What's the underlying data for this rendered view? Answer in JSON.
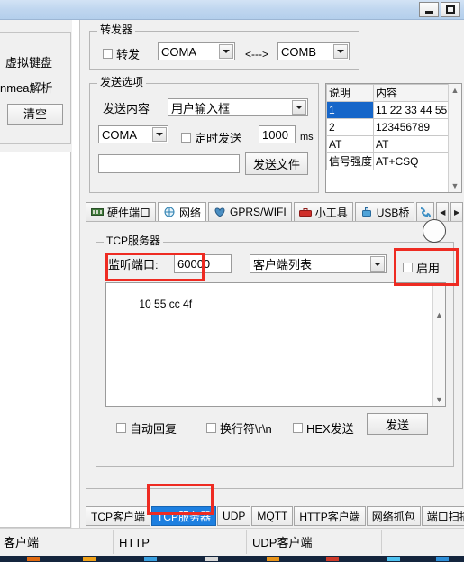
{
  "window": {
    "minimize_label": "minimize",
    "maximize_label": "maximize"
  },
  "left_panel": {
    "virtual_keyboard_label": "虚拟键盘",
    "nmea_label": "nmea解析",
    "clear_button": "清空"
  },
  "forwarder": {
    "group_title": "转发器",
    "forward_checkbox": "转发",
    "source_port": "COMA",
    "link_symbol": "<--->",
    "target_port": "COMB"
  },
  "send_options": {
    "group_title": "发送选项",
    "content_label": "发送内容",
    "content_value": "用户输入框",
    "port_value": "COMA",
    "timed_send_checkbox": "定时发送",
    "interval_value": "1000",
    "interval_unit": "ms",
    "file_path_value": "",
    "send_file_button": "发送文件"
  },
  "command_table": {
    "headers": [
      "说明",
      "内容"
    ],
    "rows": [
      {
        "desc": "1",
        "content": "11 22 33 44 55",
        "selected": true
      },
      {
        "desc": "2",
        "content": "123456789",
        "selected": false
      },
      {
        "desc": "AT",
        "content": "AT",
        "selected": false
      },
      {
        "desc": "信号强度",
        "content": "AT+CSQ",
        "selected": false
      }
    ]
  },
  "main_tabs": {
    "items": [
      {
        "label": "硬件端口",
        "icon": "hardware-port-icon",
        "active": false
      },
      {
        "label": "网络",
        "icon": "network-icon",
        "active": true
      },
      {
        "label": "GPRS/WIFI",
        "icon": "gprs-wifi-icon",
        "active": false
      },
      {
        "label": "小工具",
        "icon": "toolbox-icon",
        "active": false
      },
      {
        "label": "USB桥",
        "icon": "usb-bridge-icon",
        "active": false
      }
    ],
    "scroll_left": "◀",
    "scroll_right": "▶"
  },
  "tcp_server": {
    "group_title": "TCP服务器",
    "listen_port_label": "监听端口:",
    "listen_port_value": "60000",
    "client_list_value": "客户端列表",
    "enable_checkbox": "启用",
    "led_state": "off",
    "log_text": "10 55 cc 4f",
    "auto_reply_checkbox": "自动回复",
    "newline_checkbox": "换行符\\r\\n",
    "hex_send_checkbox": "HEX发送",
    "send_button": "发送"
  },
  "bottom_tabs": {
    "items": [
      {
        "label": "TCP客户端",
        "active": false
      },
      {
        "label": "TCP服务器",
        "active": true
      },
      {
        "label": "UDP",
        "active": false
      },
      {
        "label": "MQTT",
        "active": false
      },
      {
        "label": "HTTP客户端",
        "active": false
      },
      {
        "label": "网络抓包",
        "active": false
      },
      {
        "label": "端口扫描",
        "active": false
      }
    ]
  },
  "status_bar": {
    "cells": [
      "客户端",
      "HTTP",
      "UDP客户端",
      ""
    ]
  },
  "colors": {
    "highlight": "#ee2b22",
    "tab_active": "#1d7fe0",
    "row_selected": "#1666c9"
  }
}
